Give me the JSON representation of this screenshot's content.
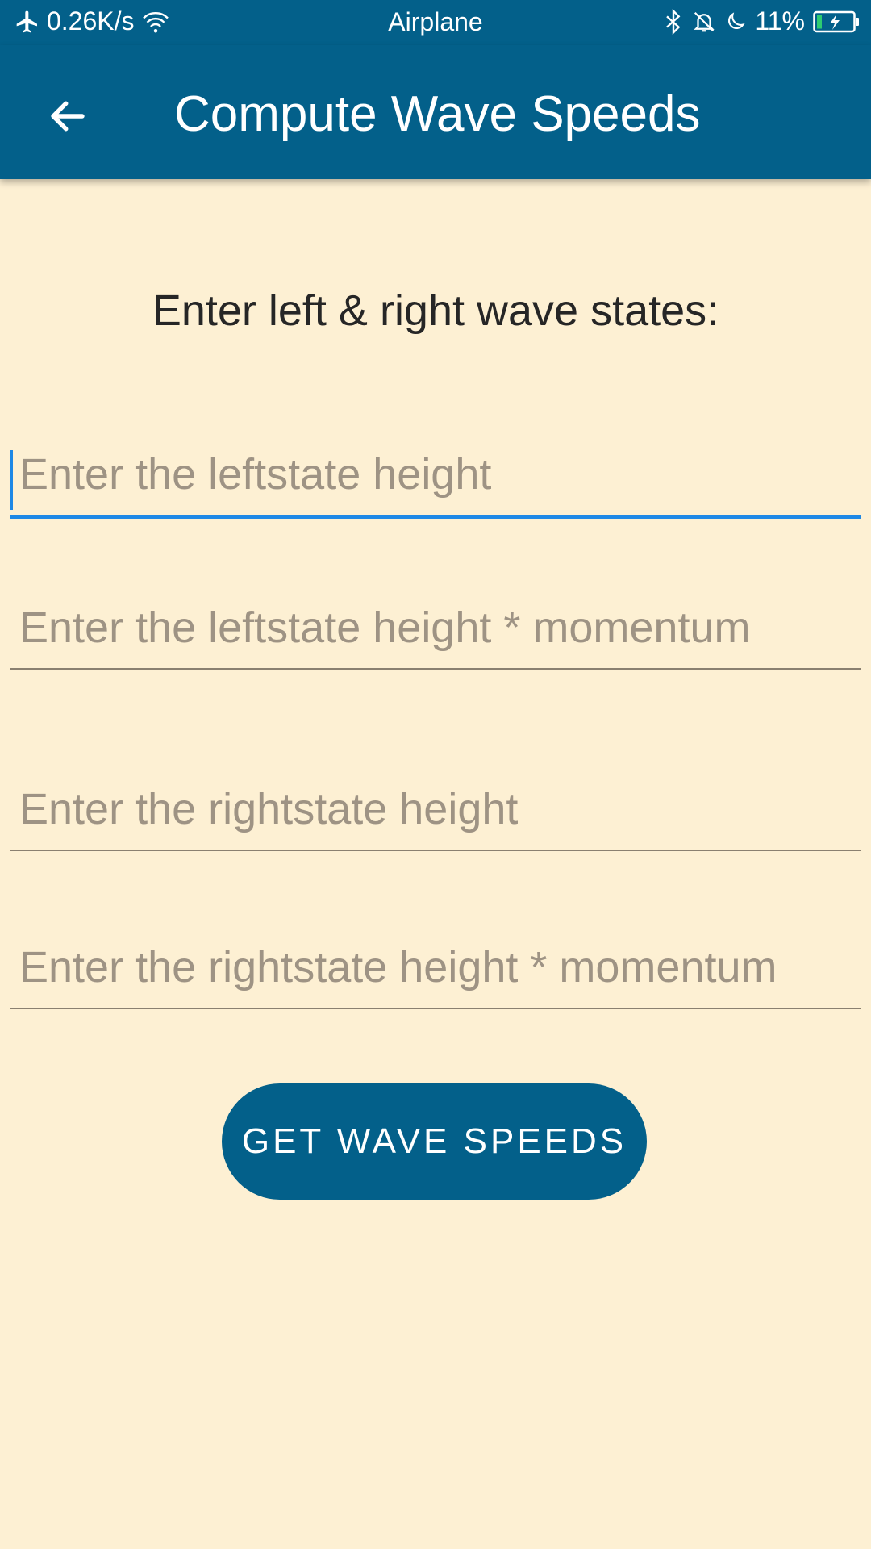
{
  "status_bar": {
    "network_speed": "0.26K/s",
    "mode_label": "Airplane",
    "battery_percent": "11%",
    "icons": [
      "airplane-icon",
      "wifi-icon",
      "bluetooth-icon",
      "bell-muted-icon",
      "moon-icon",
      "battery-charging-icon"
    ]
  },
  "app_bar": {
    "title": "Compute Wave Speeds",
    "back_icon": "arrow-back-icon"
  },
  "form": {
    "prompt": "Enter left & right wave states:",
    "fields": [
      {
        "value": "",
        "placeholder": "Enter the leftstate height",
        "focused": true
      },
      {
        "value": "",
        "placeholder": "Enter the leftstate height * momentum",
        "focused": false
      },
      {
        "value": "",
        "placeholder": "Enter the rightstate height",
        "focused": false
      },
      {
        "value": "",
        "placeholder": "Enter the rightstate height * momentum",
        "focused": false
      }
    ],
    "submit_label": "GET WAVE SPEEDS"
  },
  "colors": {
    "primary": "#03608a",
    "background": "#fdf0d3",
    "accent": "#1e88e5",
    "placeholder": "#9e9384"
  }
}
